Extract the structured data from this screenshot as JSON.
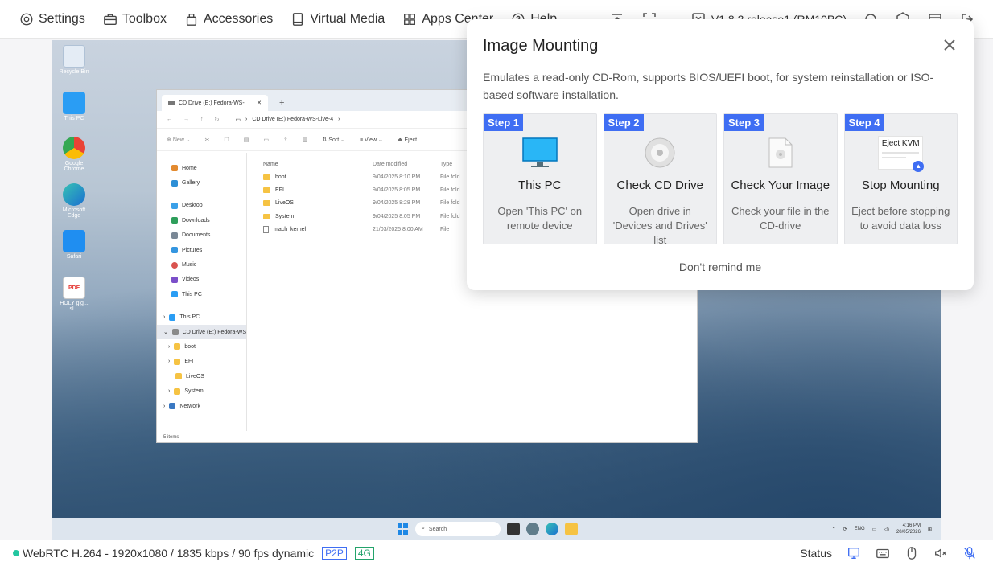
{
  "toolbar": {
    "settings": "Settings",
    "toolbox": "Toolbox",
    "accessories": "Accessories",
    "virtual_media": "Virtual Media",
    "apps_center": "Apps Center",
    "help": "Help",
    "version": "V1.8.2 release1 (RM10PC)"
  },
  "desktop": {
    "icons": [
      "Recycle Bin",
      "This PC",
      "Google Chrome",
      "Microsoft Edge",
      "Safari",
      "HOLY gig... sl..."
    ]
  },
  "explorer": {
    "tab_title": "CD Drive (E:) Fedora-WS-",
    "add_tab": "+",
    "path": "CD Drive (E:) Fedora-WS-Live-4",
    "cmd_new": "New",
    "cmd_sort": "Sort",
    "cmd_view": "View",
    "cmd_eject": "Eject",
    "nav": {
      "home": "Home",
      "gallery": "Gallery",
      "desktop": "Desktop",
      "downloads": "Downloads",
      "documents": "Documents",
      "pictures": "Pictures",
      "music": "Music",
      "videos": "Videos",
      "this_pc": "This PC",
      "this_pc_2": "This PC",
      "cd_drive": "CD Drive (E:) Fedora-WS",
      "boot": "boot",
      "efi": "EFI",
      "liveos": "LiveOS",
      "system": "System",
      "network": "Network"
    },
    "columns": {
      "name": "Name",
      "date": "Date modified",
      "type": "Type"
    },
    "files": [
      {
        "name": "boot",
        "date": "9/04/2025 8:10 PM",
        "type": "File fold"
      },
      {
        "name": "EFI",
        "date": "9/04/2025 8:05 PM",
        "type": "File fold"
      },
      {
        "name": "LiveOS",
        "date": "9/04/2025 8:28 PM",
        "type": "File fold"
      },
      {
        "name": "System",
        "date": "9/04/2025 8:05 PM",
        "type": "File fold"
      },
      {
        "name": "mach_kernel",
        "date": "21/03/2025 8:00 AM",
        "type": "File"
      }
    ],
    "status": "5 items"
  },
  "taskbar": {
    "search": "Search",
    "lang": "ENG",
    "time": "4:16 PM",
    "date": "20/05/2026"
  },
  "status": {
    "stream": "WebRTC H.264 - 1920x1080 / 1835 kbps / 90 fps dynamic",
    "p2p": "P2P",
    "net": "4G",
    "status_label": "Status"
  },
  "popup": {
    "title": "Image Mounting",
    "desc": "Emulates a read-only CD-Rom, supports BIOS/UEFI boot, for system reinstallation or ISO-based software installation.",
    "steps": [
      {
        "tag": "Step 1",
        "title": "This PC",
        "desc": "Open 'This PC' on remote device"
      },
      {
        "tag": "Step 2",
        "title": "Check CD Drive",
        "desc": "Open drive in 'Devices and Drives' list"
      },
      {
        "tag": "Step 3",
        "title": "Check Your Image",
        "desc": "Check your file in the CD-drive"
      },
      {
        "tag": "Step 4",
        "title": "Stop Mounting",
        "desc": "Eject before stopping to avoid data loss",
        "art_label": "Eject KVM"
      }
    ],
    "dont_remind": "Don't remind me"
  },
  "colors": {
    "accent": "#3f6ef3",
    "p2p": "#3f6ef3",
    "net": "#23a36b",
    "online": "#23c6a0"
  }
}
